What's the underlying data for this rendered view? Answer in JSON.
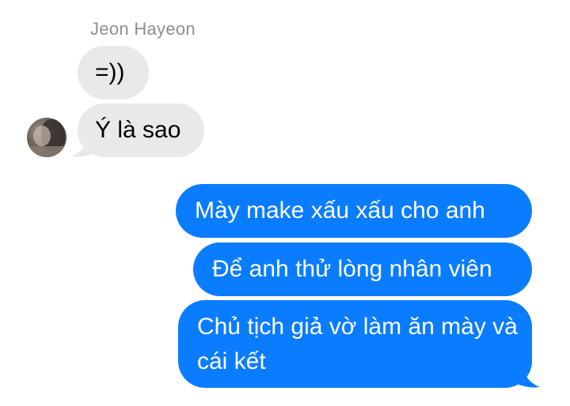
{
  "conversation": {
    "sender_name": "Jeon Hayeon",
    "messages": [
      {
        "direction": "incoming",
        "text": "=))"
      },
      {
        "direction": "incoming",
        "text": "Ý là sao"
      },
      {
        "direction": "outgoing",
        "text": "Mày make xấu xấu cho anh"
      },
      {
        "direction": "outgoing",
        "text": "Để anh thử lòng nhân viên"
      },
      {
        "direction": "outgoing",
        "text": "Chủ tịch giả vờ làm ăn mày và cái kết"
      }
    ]
  },
  "colors": {
    "incoming_bubble": "#e9e9eb",
    "outgoing_bubble": "#0a7cff",
    "sender_name": "#8e8e93"
  },
  "icons": {
    "avatar": "profile-photo"
  }
}
